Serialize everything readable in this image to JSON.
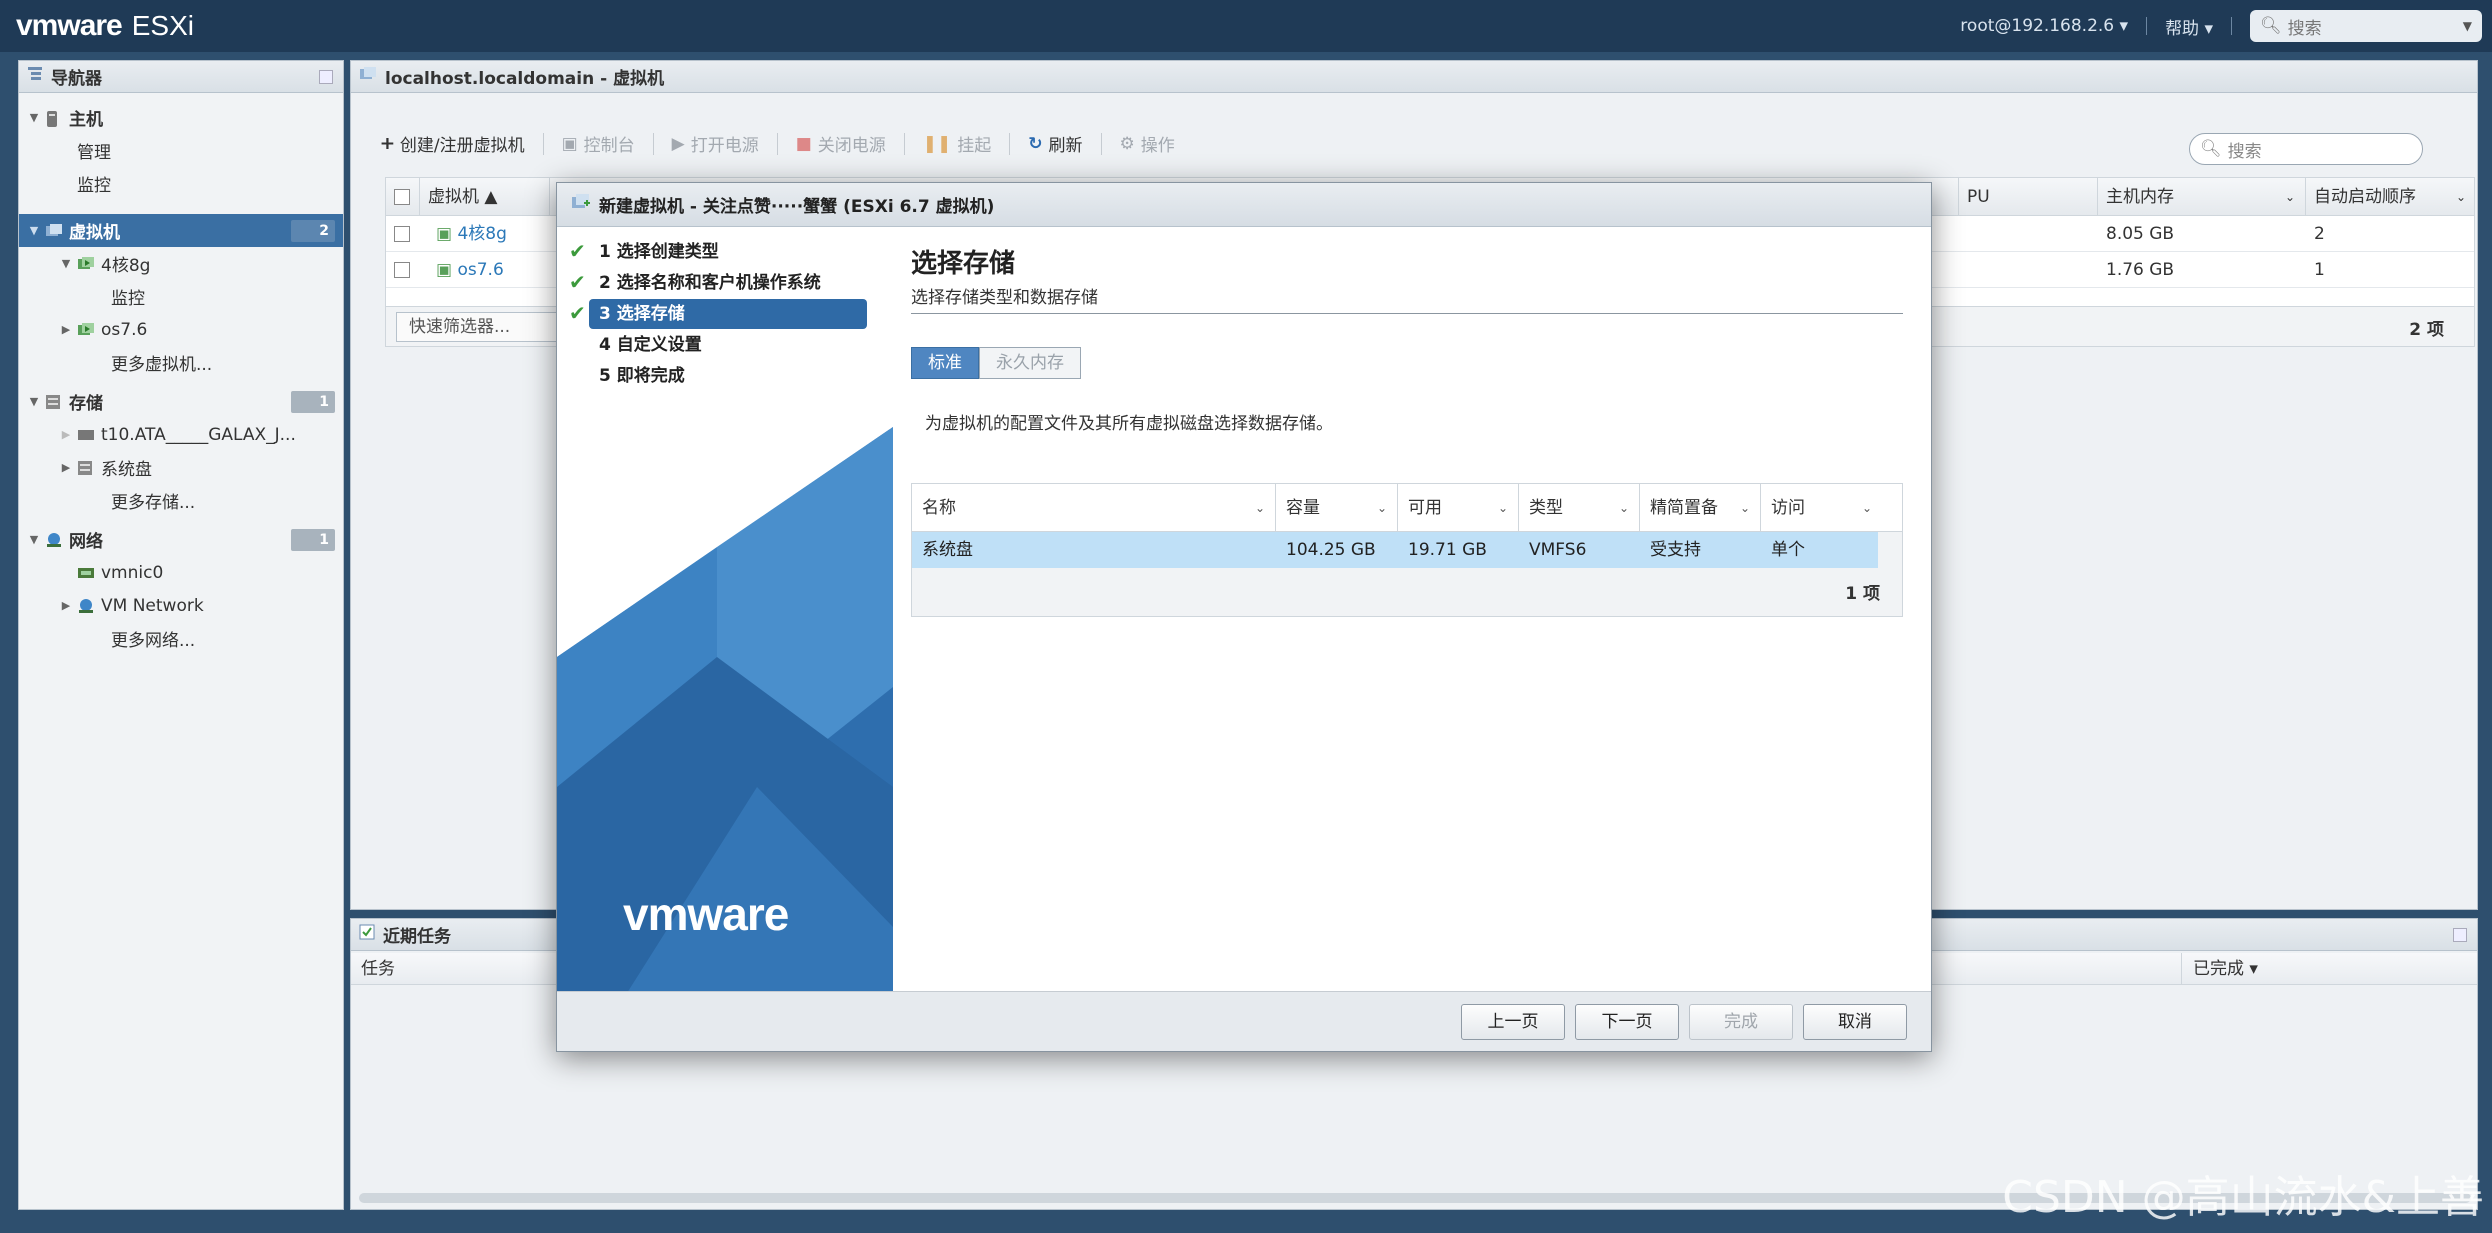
{
  "topbar": {
    "brand_vm": "vmware",
    "brand_product": "ESXi",
    "user": "root@192.168.2.6",
    "help": "帮助",
    "search_placeholder": "搜索"
  },
  "navigator": {
    "title": "导航器",
    "items": [
      {
        "label": "主机",
        "level": 0
      },
      {
        "label": "管理",
        "level": 1
      },
      {
        "label": "监控",
        "level": 1
      },
      {
        "label": "虚拟机",
        "level": 0,
        "badge": "2"
      },
      {
        "label": "4核8g",
        "level": 1
      },
      {
        "label": "监控",
        "level": 2
      },
      {
        "label": "os7.6",
        "level": 1
      },
      {
        "label": "更多虚拟机...",
        "level": 2
      },
      {
        "label": "存储",
        "level": 0,
        "badge": "1"
      },
      {
        "label": "t10.ATA_____GALAX_J...",
        "level": 1
      },
      {
        "label": "系统盘",
        "level": 1
      },
      {
        "label": "更多存储...",
        "level": 2
      },
      {
        "label": "网络",
        "level": 0,
        "badge": "1"
      },
      {
        "label": "vmnic0",
        "level": 1
      },
      {
        "label": "VM Network",
        "level": 1
      },
      {
        "label": "更多网络...",
        "level": 2
      }
    ]
  },
  "main": {
    "title": "localhost.localdomain - 虚拟机",
    "toolbar": [
      "创建/注册虚拟机",
      "控制台",
      "打开电源",
      "关闭电源",
      "挂起",
      "刷新",
      "操作"
    ],
    "search_placeholder": "搜索",
    "columns": [
      "虚拟机 ▲",
      "PU",
      "主机内存",
      "自动启动顺序"
    ],
    "rows": [
      {
        "name": "4核8g",
        "mem": "8.05 GB",
        "order": "2"
      },
      {
        "name": "os7.6",
        "mem": "1.76 GB",
        "order": "1"
      }
    ],
    "quick_filter": "快速筛选器...",
    "count": "2 项"
  },
  "tasks": {
    "title": "近期任务",
    "col_task": "任务",
    "col_done": "已完成 ▾"
  },
  "dialog": {
    "title": "新建虚拟机 - 关注点赞·····蟹蟹 (ESXi 6.7 虚拟机)",
    "steps": [
      "1 选择创建类型",
      "2 选择名称和客户机操作系统",
      "3 选择存储",
      "4 自定义设置",
      "5 即将完成"
    ],
    "logo": "vmware",
    "heading": "选择存储",
    "subheading": "选择存储类型和数据存储",
    "seg_standard": "标准",
    "seg_pmem": "永久内存",
    "description": "为虚拟机的配置文件及其所有虚拟磁盘选择数据存储。",
    "columns": [
      "名称",
      "容量",
      "可用",
      "类型",
      "精简置备",
      "访问"
    ],
    "row": [
      "系统盘",
      "104.25 GB",
      "19.71 GB",
      "VMFS6",
      "受支持",
      "单个"
    ],
    "count": "1 项",
    "buttons": {
      "back": "上一页",
      "next": "下一页",
      "finish": "完成",
      "cancel": "取消"
    }
  },
  "watermark": "CSDN @高山流水&上善"
}
